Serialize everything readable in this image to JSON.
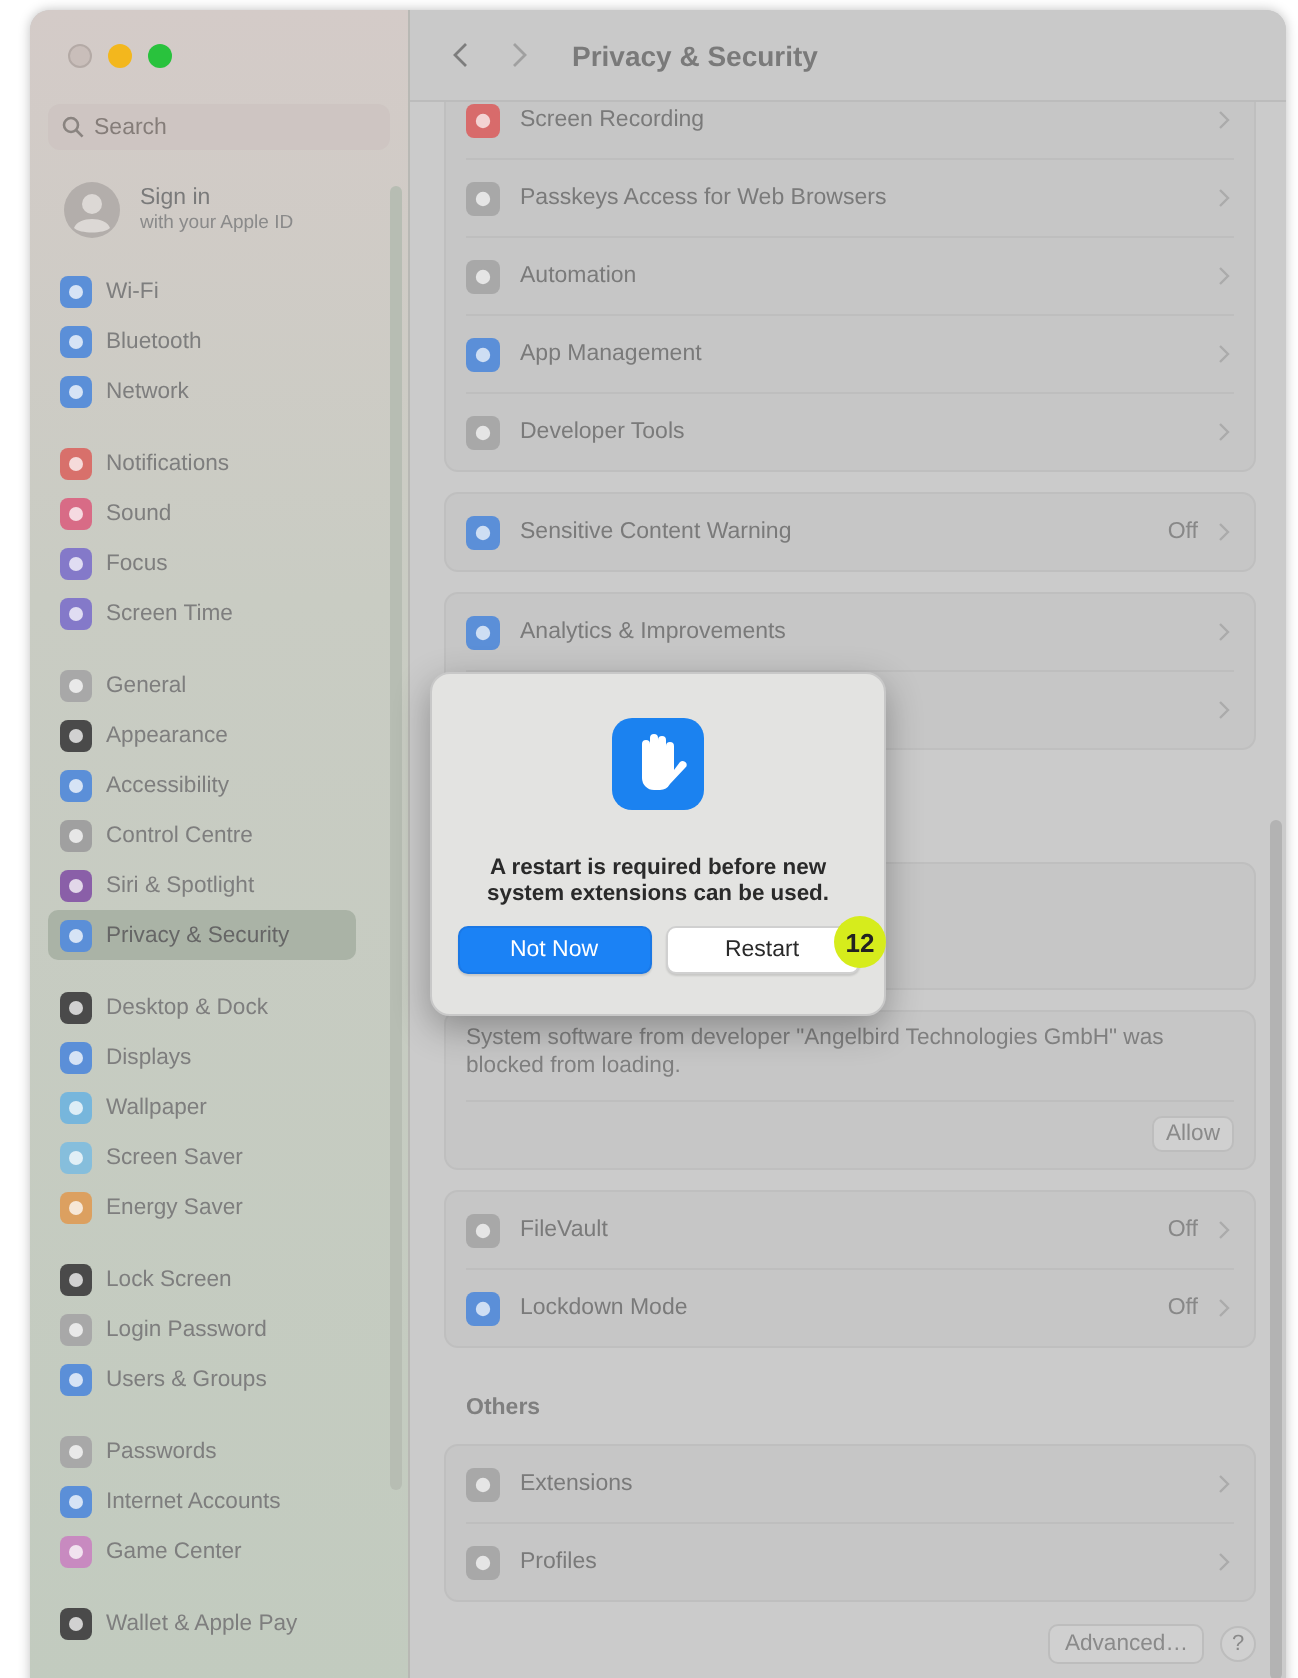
{
  "window": {
    "title": "Privacy & Security"
  },
  "sidebar": {
    "search": {
      "placeholder": "Search"
    },
    "account": {
      "title": "Sign in",
      "subtitle": "with your Apple ID"
    },
    "groups": [
      [
        {
          "label": "Wi-Fi",
          "color": "#5b8fd8",
          "selected": false
        },
        {
          "label": "Bluetooth",
          "color": "#5b8fd8",
          "selected": false
        },
        {
          "label": "Network",
          "color": "#5b8fd8",
          "selected": false
        }
      ],
      [
        {
          "label": "Notifications",
          "color": "#d8706b",
          "selected": false
        },
        {
          "label": "Sound",
          "color": "#d86b86",
          "selected": false
        },
        {
          "label": "Focus",
          "color": "#8479c9",
          "selected": false
        },
        {
          "label": "Screen Time",
          "color": "#8479c9",
          "selected": false
        }
      ],
      [
        {
          "label": "General",
          "color": "#a8a8a8",
          "selected": false
        },
        {
          "label": "Appearance",
          "color": "#4a4a4a",
          "selected": false
        },
        {
          "label": "Accessibility",
          "color": "#5b8fd8",
          "selected": false
        },
        {
          "label": "Control Centre",
          "color": "#a0a0a0",
          "selected": false
        },
        {
          "label": "Siri & Spotlight",
          "color": "#8a5fa8",
          "selected": false
        },
        {
          "label": "Privacy & Security",
          "color": "#5b8fd8",
          "selected": true
        }
      ],
      [
        {
          "label": "Desktop & Dock",
          "color": "#4a4a4a",
          "selected": false
        },
        {
          "label": "Displays",
          "color": "#5b8fd8",
          "selected": false
        },
        {
          "label": "Wallpaper",
          "color": "#77b6dc",
          "selected": false
        },
        {
          "label": "Screen Saver",
          "color": "#86bedc",
          "selected": false
        },
        {
          "label": "Energy Saver",
          "color": "#dca060",
          "selected": false
        }
      ],
      [
        {
          "label": "Lock Screen",
          "color": "#4a4a4a",
          "selected": false
        },
        {
          "label": "Login Password",
          "color": "#a8a8a8",
          "selected": false
        },
        {
          "label": "Users & Groups",
          "color": "#5b8fd8",
          "selected": false
        }
      ],
      [
        {
          "label": "Passwords",
          "color": "#a8a8a8",
          "selected": false
        },
        {
          "label": "Internet Accounts",
          "color": "#5b8fd8",
          "selected": false
        },
        {
          "label": "Game Center",
          "color": "#c88ac0",
          "selected": false
        }
      ],
      [
        {
          "label": "Wallet & Apple Pay",
          "color": "#4a4a4a",
          "selected": false
        }
      ]
    ]
  },
  "content": [
    {
      "kind": "card",
      "rows": [
        {
          "label": "Screen Recording",
          "color": "#d86b6b"
        },
        {
          "label": "Passkeys Access for Web Browsers",
          "color": "#a8a8a8"
        },
        {
          "label": "Automation",
          "color": "#a8a8a8"
        },
        {
          "label": "App Management",
          "color": "#5b8fd8"
        },
        {
          "label": "Developer Tools",
          "color": "#a8a8a8"
        }
      ]
    },
    {
      "kind": "card",
      "rows": [
        {
          "label": "Sensitive Content Warning",
          "value": "Off",
          "color": "#5b8fd8"
        }
      ]
    },
    {
      "kind": "card",
      "rows": [
        {
          "label": "Analytics & Improvements",
          "color": "#5b8fd8"
        },
        {}
      ]
    },
    {
      "kind": "hidden"
    },
    {
      "kind": "message",
      "text": "System software from developer \"Angelbird Technologies GmbH\" was blocked from loading.",
      "button": "Allow"
    },
    {
      "kind": "card",
      "rows": [
        {
          "label": "FileVault",
          "value": "Off",
          "color": "#a8a8a8"
        },
        {
          "label": "Lockdown Mode",
          "value": "Off",
          "color": "#5b8fd8"
        }
      ]
    },
    {
      "kind": "heading",
      "text": "Others"
    },
    {
      "kind": "card",
      "rows": [
        {
          "label": "Extensions",
          "color": "#a8a8a8"
        },
        {
          "label": "Profiles",
          "color": "#a8a8a8"
        }
      ]
    }
  ],
  "footer": {
    "advanced": "Advanced…",
    "help": "?"
  },
  "dialog": {
    "message": "A restart is required before new system extensions can be used.",
    "buttons": [
      {
        "label": "Not Now",
        "kind": "primary"
      },
      {
        "label": "Restart",
        "kind": "default"
      }
    ],
    "badge": "12"
  }
}
